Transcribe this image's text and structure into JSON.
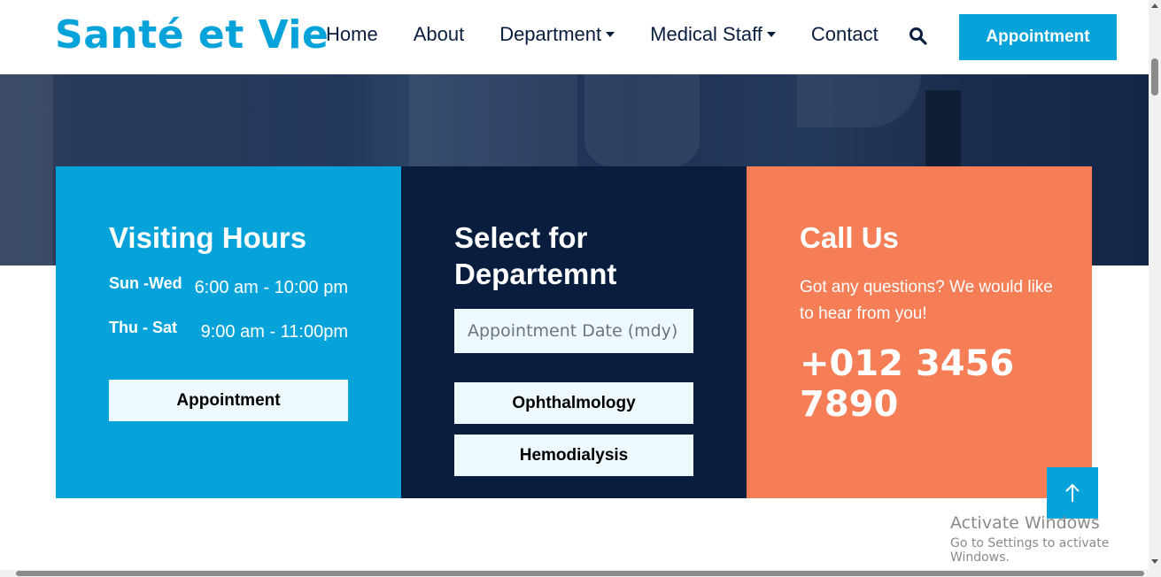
{
  "brand": {
    "name": "Santé et Vie",
    "color": "#06a3da"
  },
  "nav": {
    "items": [
      {
        "label": "Home",
        "dropdown": false
      },
      {
        "label": "About",
        "dropdown": false
      },
      {
        "label": "Department",
        "dropdown": true
      },
      {
        "label": "Medical Staff",
        "dropdown": true
      },
      {
        "label": "Contact",
        "dropdown": false
      }
    ],
    "search_icon": "search-icon",
    "appointment_label": "Appointment"
  },
  "hours_card": {
    "title": "Visiting Hours",
    "rows": [
      {
        "day": "Sun -Wed",
        "time": "6:00 am - 10:00 pm"
      },
      {
        "day": "Thu - Sat",
        "time": "9:00 am - 11:00pm"
      }
    ],
    "button_label": "Appointment",
    "color": "#06a3da"
  },
  "dept_card": {
    "title_line1": "Select for",
    "title_line2": "Departemnt",
    "date_placeholder": "Appointment Date (mdy)",
    "departments": [
      "Ophthalmology",
      "Hemodialysis"
    ],
    "color": "#091e3e"
  },
  "call_card": {
    "title": "Call Us",
    "text": "Got any questions? We would like to hear from you!",
    "phone_line1": "+012 3456",
    "phone_line2": "7890",
    "color": "#f57e57"
  },
  "back_to_top_icon": "arrow-up-icon",
  "watermark": {
    "line1": "Activate Windows",
    "line2": "Go to Settings to activate Windows."
  }
}
